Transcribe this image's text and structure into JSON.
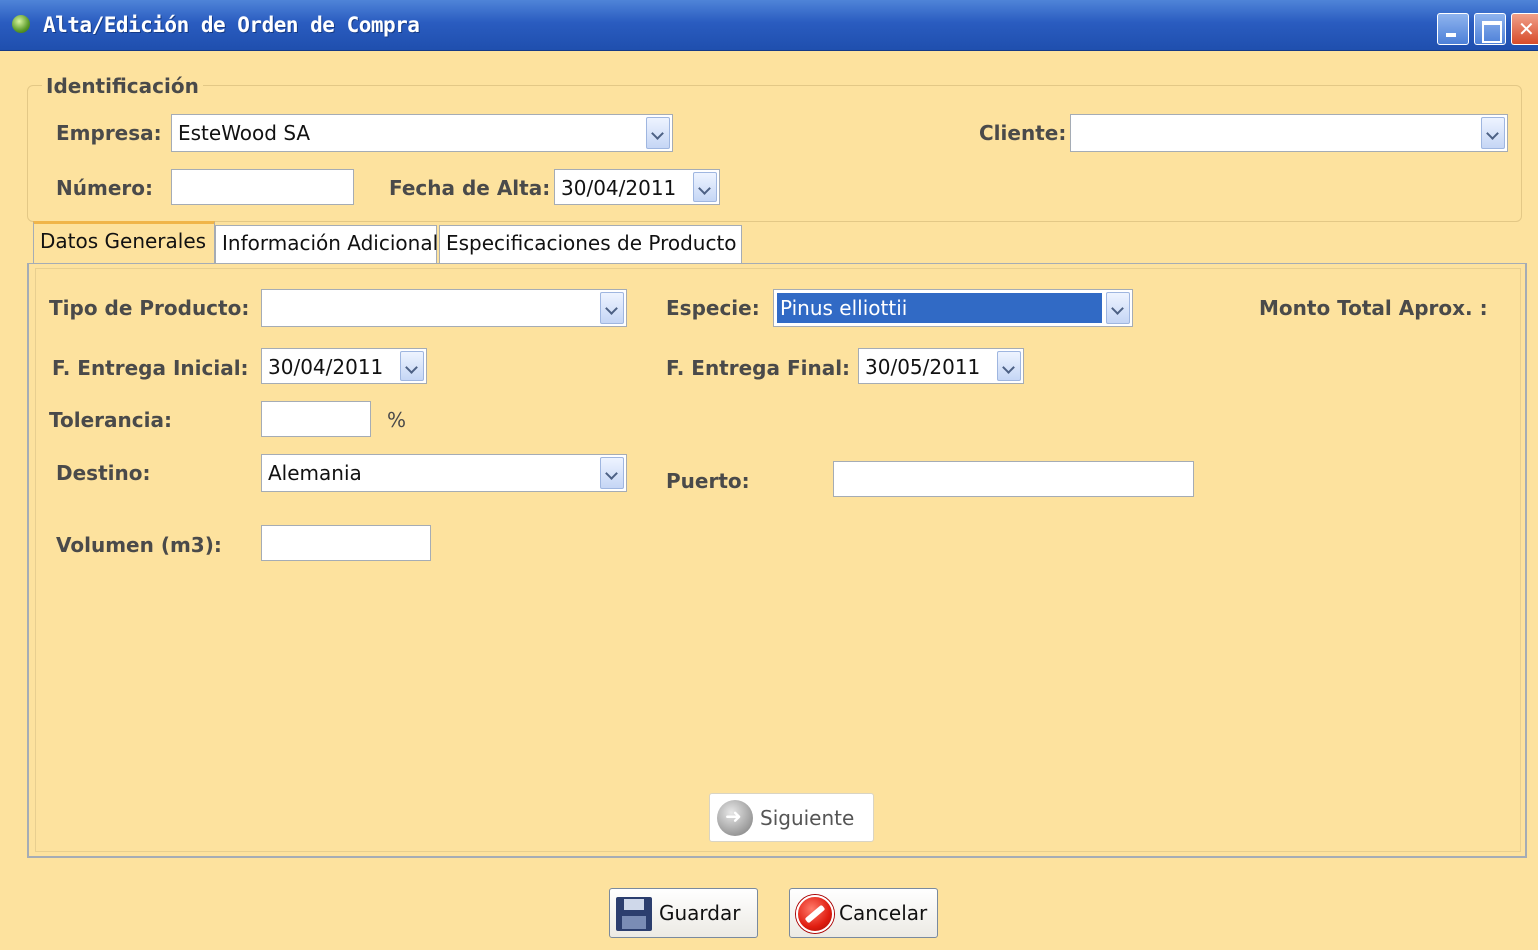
{
  "window": {
    "title": "Alta/Edición de Orden de Compra"
  },
  "identificacion": {
    "legend": "Identificación",
    "empresa_label": "Empresa:",
    "empresa_value": "EsteWood SA",
    "cliente_label": "Cliente:",
    "cliente_value": "",
    "numero_label": "Número:",
    "numero_value": "",
    "fecha_alta_label": "Fecha de Alta:",
    "fecha_alta_value": "30/04/2011"
  },
  "tabs": [
    {
      "label": "Datos Generales",
      "active": true
    },
    {
      "label": "Información Adicional",
      "active": false
    },
    {
      "label": "Especificaciones de Producto",
      "active": false
    }
  ],
  "datos_generales": {
    "tipo_producto_label": "Tipo de Producto:",
    "tipo_producto_value": "",
    "especie_label": "Especie:",
    "especie_value": "Pinus elliottii",
    "monto_label": "Monto Total Aprox. :",
    "f_entrega_inicial_label": "F. Entrega Inicial:",
    "f_entrega_inicial_value": "30/04/2011",
    "f_entrega_final_label": "F. Entrega Final:",
    "f_entrega_final_value": "30/05/2011",
    "tolerancia_label": "Tolerancia:",
    "tolerancia_value": "",
    "tolerancia_unit": "%",
    "destino_label": "Destino:",
    "destino_value": "Alemania",
    "puerto_label": "Puerto:",
    "puerto_value": "",
    "volumen_label": "Volumen (m3):",
    "volumen_value": "",
    "siguiente_label": "Siguiente"
  },
  "footer": {
    "guardar_label": "Guardar",
    "cancelar_label": "Cancelar"
  }
}
